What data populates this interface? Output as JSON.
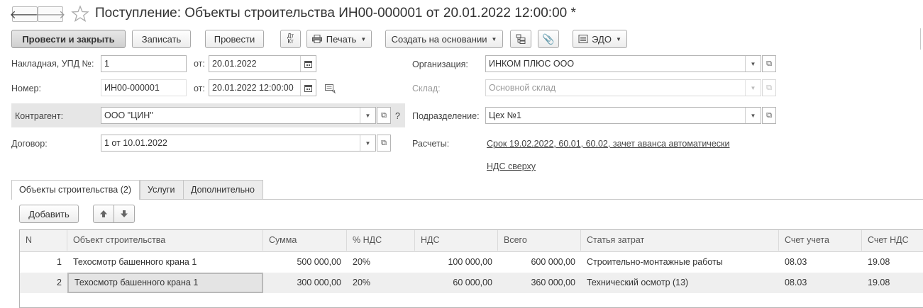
{
  "window": {
    "title": "Поступление: Объекты строительства ИН00-000001 от 20.01.2022 12:00:00 *"
  },
  "toolbar": {
    "post_and_close": "Провести и закрыть",
    "save": "Записать",
    "post": "Провести",
    "dt_kt_top": "Дт",
    "dt_kt_bottom": "Кт",
    "print": "Печать",
    "create_based_on": "Создать на основании",
    "edo": "ЭДО"
  },
  "header": {
    "invoice_label": "Накладная, УПД №:",
    "invoice_number": "1",
    "invoice_from_label": "от:",
    "invoice_date": "20.01.2022",
    "number_label": "Номер:",
    "number_value": "ИН00-000001",
    "number_from_label": "от:",
    "number_datetime": "20.01.2022 12:00:00",
    "counterparty_label": "Контрагент:",
    "counterparty_value": "ООО \"ЦИН\"",
    "help_mark": "?",
    "contract_label": "Договор:",
    "contract_value": "1 от 10.01.2022",
    "organization_label": "Организация:",
    "organization_value": "ИНКОМ ПЛЮС ООО",
    "warehouse_label": "Склад:",
    "warehouse_value": "Основной склад",
    "department_label": "Подразделение:",
    "department_value": "Цех №1",
    "settlements_label": "Расчеты:",
    "settlements_link": "Срок 19.02.2022, 60.01, 60.02, зачет аванса автоматически",
    "vat_link": "НДС сверху"
  },
  "tabs": [
    {
      "label": "Объекты строительства (2)",
      "active": true
    },
    {
      "label": "Услуги",
      "active": false
    },
    {
      "label": "Дополнительно",
      "active": false
    }
  ],
  "table_toolbar": {
    "add": "Добавить"
  },
  "table": {
    "columns": [
      "N",
      "Объект строительства",
      "Сумма",
      "% НДС",
      "НДС",
      "Всего",
      "Статья затрат",
      "Счет учета",
      "Счет НДС"
    ],
    "rows": [
      {
        "n": "1",
        "object": "Техосмотр башенного крана 1",
        "sum": "500 000,00",
        "vat_rate": "20%",
        "vat": "100 000,00",
        "total": "600 000,00",
        "cost_item": "Строительно-монтажные работы",
        "account": "08.03",
        "vat_account": "19.08"
      },
      {
        "n": "2",
        "object": "Техосмотр башенного крана 1",
        "sum": "300 000,00",
        "vat_rate": "20%",
        "vat": "60 000,00",
        "total": "360 000,00",
        "cost_item": "Технический осмотр (13)",
        "account": "08.03",
        "vat_account": "19.08"
      }
    ]
  },
  "icons": [
    "back-arrow-icon",
    "forward-arrow-icon",
    "star-icon",
    "printer-icon",
    "structure-icon",
    "paperclip-icon",
    "edo-icon",
    "calendar-icon",
    "dropdown-icon",
    "open-icon",
    "comment-icon",
    "move-up-icon",
    "move-down-icon"
  ]
}
